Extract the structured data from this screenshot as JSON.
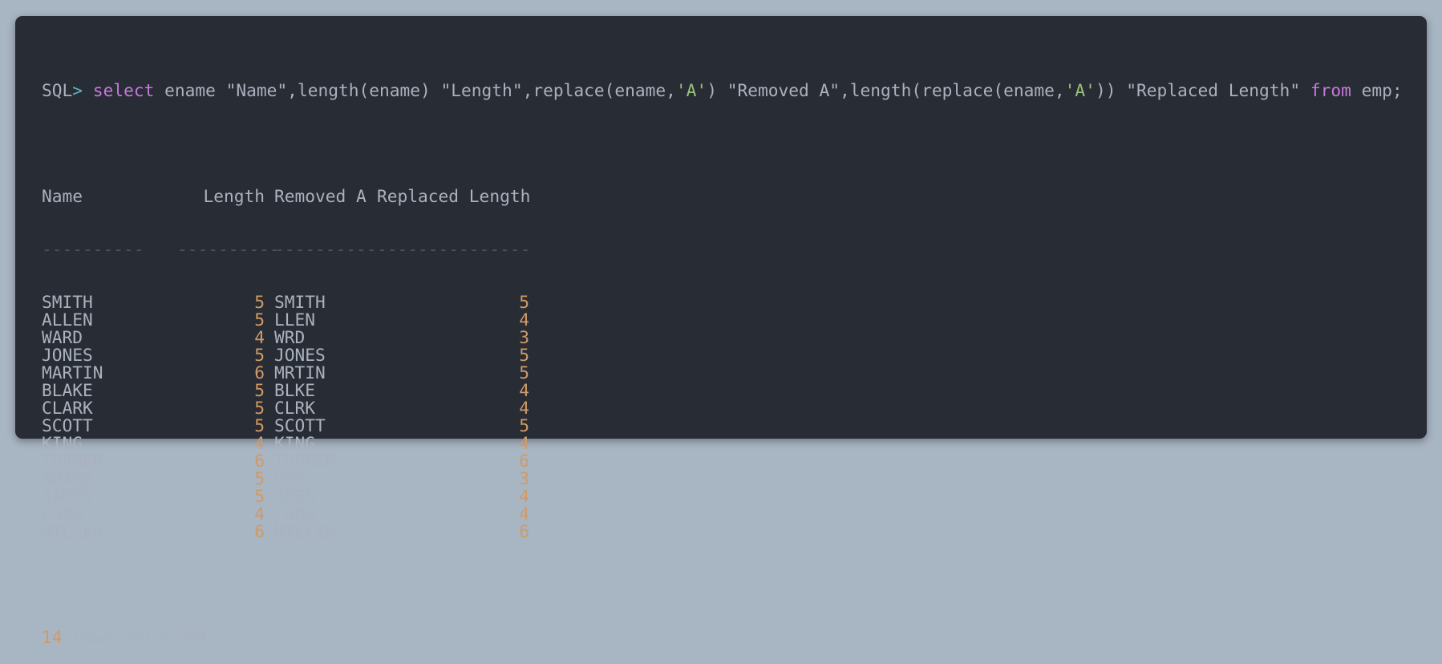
{
  "command": {
    "prompt": "SQL",
    "prompt_symbol": ">",
    "kw_select": "select",
    "part1": " ename \"Name\",length(ename) \"Length\",replace(ename,",
    "str1": "'A'",
    "part2": ") \"Removed A\",length(replace(ename,",
    "str2": "'A'",
    "part3": ")) \"Replaced Length\" ",
    "kw_from": "from",
    "part4": " emp;"
  },
  "table": {
    "headers": [
      "Name",
      "Length",
      "Removed A",
      "Replaced Length"
    ],
    "separators": [
      "----------",
      "----------",
      "----------",
      "---------------"
    ],
    "rows": [
      {
        "name": "SMITH",
        "length": "5",
        "removed": "SMITH",
        "replaced": "5"
      },
      {
        "name": "ALLEN",
        "length": "5",
        "removed": "LLEN",
        "replaced": "4"
      },
      {
        "name": "WARD",
        "length": "4",
        "removed": "WRD",
        "replaced": "3"
      },
      {
        "name": "JONES",
        "length": "5",
        "removed": "JONES",
        "replaced": "5"
      },
      {
        "name": "MARTIN",
        "length": "6",
        "removed": "MRTIN",
        "replaced": "5"
      },
      {
        "name": "BLAKE",
        "length": "5",
        "removed": "BLKE",
        "replaced": "4"
      },
      {
        "name": "CLARK",
        "length": "5",
        "removed": "CLRK",
        "replaced": "4"
      },
      {
        "name": "SCOTT",
        "length": "5",
        "removed": "SCOTT",
        "replaced": "5"
      },
      {
        "name": "KING",
        "length": "4",
        "removed": "KING",
        "replaced": "4"
      },
      {
        "name": "TURNER",
        "length": "6",
        "removed": "TURNER",
        "replaced": "6"
      },
      {
        "name": "ADAMS",
        "length": "5",
        "removed": "DMS",
        "replaced": "3"
      },
      {
        "name": "JAMES",
        "length": "5",
        "removed": "JMES",
        "replaced": "4"
      },
      {
        "name": "FORD",
        "length": "4",
        "removed": "FORD",
        "replaced": "4"
      },
      {
        "name": "MILLER",
        "length": "6",
        "removed": "MILLER",
        "replaced": "6"
      }
    ]
  },
  "footer": {
    "count": "14",
    "text": " rows selected."
  },
  "colors": {
    "background": "#a8b5c3",
    "terminal_bg": "#282c34",
    "text": "#abb2bf",
    "keyword": "#c678dd",
    "string": "#98c379",
    "number": "#d19a66",
    "prompt_symbol": "#56b6c2"
  }
}
